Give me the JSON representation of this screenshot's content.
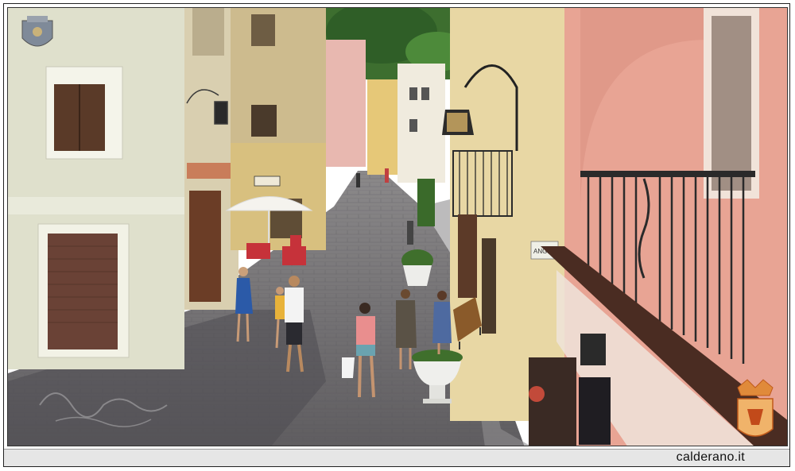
{
  "photo": {
    "alt_subject": "",
    "signage": {
      "shop_sign_left": "",
      "wall_plate_right": "ANGIPORTO"
    }
  },
  "caption": {
    "site": "calderano.it"
  },
  "colors": {
    "frame_border": "#222222",
    "caption_bar": "#e6e6e6",
    "pink_facade": "#e8a494",
    "yellow_facade": "#e8d7a4",
    "cream_facade": "#dfe0cc",
    "cobblestone": "#6f6d6e",
    "sky_trees": "#3d6e2f"
  },
  "icons": [
    "coat-of-arms-icon",
    "crown-shield-logo-icon"
  ]
}
